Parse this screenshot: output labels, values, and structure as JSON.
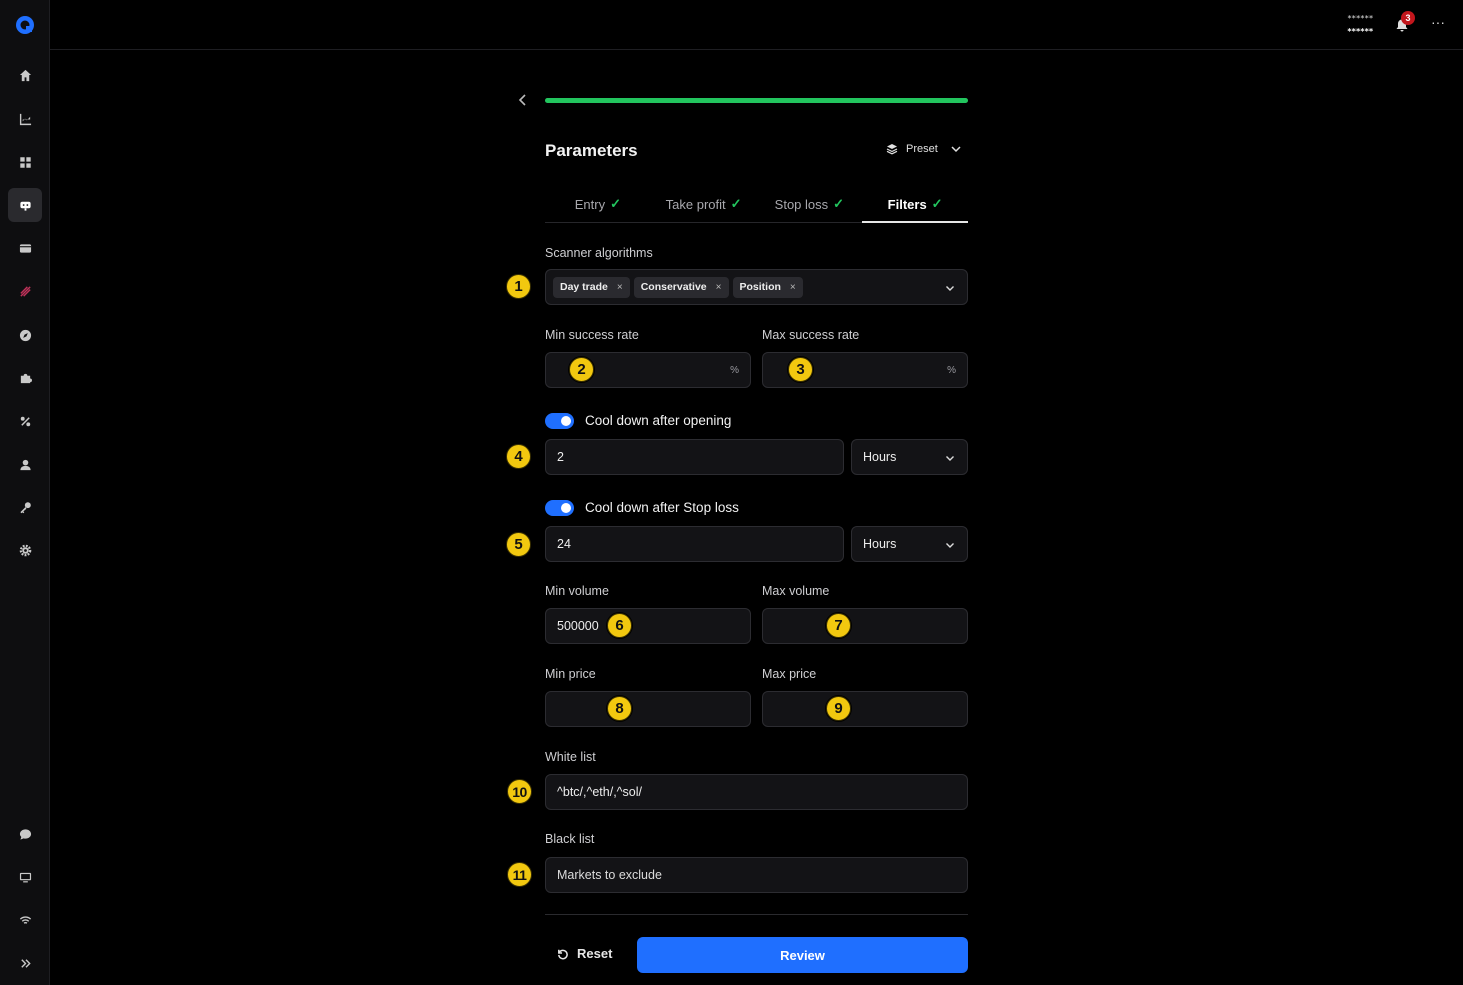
{
  "topbar": {
    "user_line1": "******",
    "user_line2": "******",
    "notifications_count": "3",
    "more": "···"
  },
  "progress": {
    "percent": 100
  },
  "header": {
    "title": "Parameters",
    "preset_label": "Preset"
  },
  "tabs": [
    {
      "label": "Entry",
      "check": "✓"
    },
    {
      "label": "Take profit",
      "check": "✓"
    },
    {
      "label": "Stop loss",
      "check": "✓"
    },
    {
      "label": "Filters",
      "check": "✓"
    }
  ],
  "scanner": {
    "label": "Scanner algorithms",
    "chips": [
      "Day trade",
      "Conservative",
      "Position"
    ],
    "remove": "×"
  },
  "success_rate": {
    "min_label": "Min success rate",
    "max_label": "Max success rate",
    "min_value": "",
    "max_value": "",
    "suffix": "%"
  },
  "cooldown_opening": {
    "label": "Cool down after opening",
    "enabled": true,
    "value": "2",
    "unit": "Hours"
  },
  "cooldown_stoploss": {
    "label": "Cool down after Stop loss",
    "enabled": true,
    "value": "24",
    "unit": "Hours"
  },
  "volume": {
    "min_label": "Min volume",
    "max_label": "Max volume",
    "min_value": "500000",
    "max_value": ""
  },
  "price": {
    "min_label": "Min price",
    "max_label": "Max price",
    "min_value": "",
    "max_value": ""
  },
  "whitelist": {
    "label": "White list",
    "value": "^btc/,^eth/,^sol/"
  },
  "blacklist": {
    "label": "Black list",
    "placeholder": "Markets to exclude"
  },
  "actions": {
    "reset_label": "Reset",
    "review_label": "Review"
  },
  "markers": [
    "1",
    "2",
    "3",
    "4",
    "5",
    "6",
    "7",
    "8",
    "9",
    "10",
    "11"
  ],
  "colors": {
    "accent": "#1f6fff",
    "success": "#22c55e",
    "marker": "#f2c80f"
  }
}
